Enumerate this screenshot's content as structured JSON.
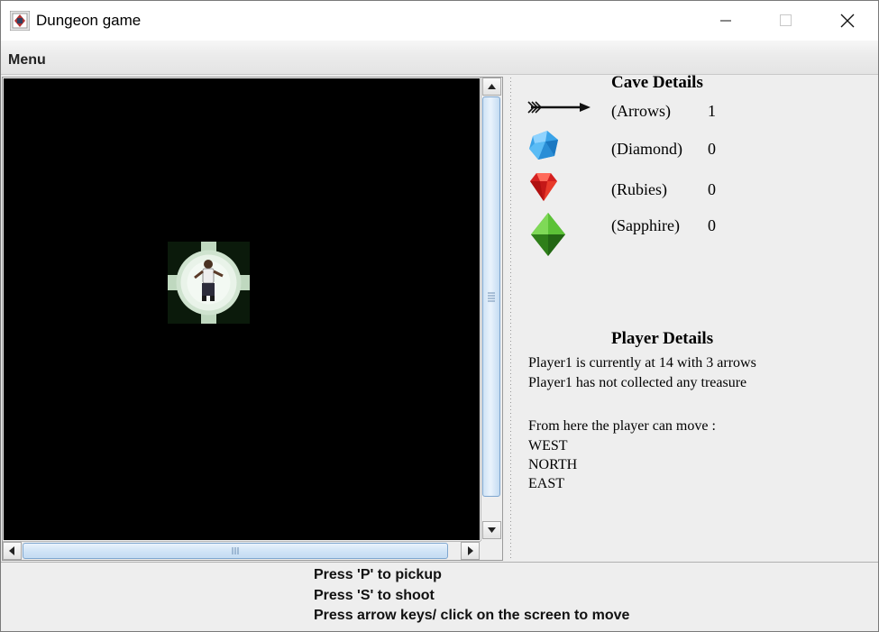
{
  "window": {
    "title": "Dungeon game"
  },
  "menubar": {
    "menu_label": "Menu"
  },
  "cave_details": {
    "heading": "Cave Details",
    "items": [
      {
        "icon": "arrow-icon",
        "label": "(Arrows)",
        "count": "1"
      },
      {
        "icon": "diamond-icon",
        "label": "(Diamond)",
        "count": "0"
      },
      {
        "icon": "ruby-icon",
        "label": "(Rubies)",
        "count": "0"
      },
      {
        "icon": "sapphire-icon",
        "label": "(Sapphire)",
        "count": "0"
      }
    ]
  },
  "player_details": {
    "heading": "Player Details",
    "location_line": "Player1 is currently at 14 with 3 arrows",
    "treasure_line": "Player1 has not collected any treasure",
    "moves_intro": "From here the player can move :",
    "moves": [
      "WEST",
      "NORTH",
      "EAST"
    ]
  },
  "instructions": {
    "pickup": "Press 'P' to pickup",
    "shoot": "Press 'S' to shoot",
    "move": "Press arrow keys/ click on the screen to move"
  },
  "colors": {
    "map_background": "#000000",
    "panel_background": "#eeeeee",
    "scroll_thumb": "#cfe3f6"
  }
}
